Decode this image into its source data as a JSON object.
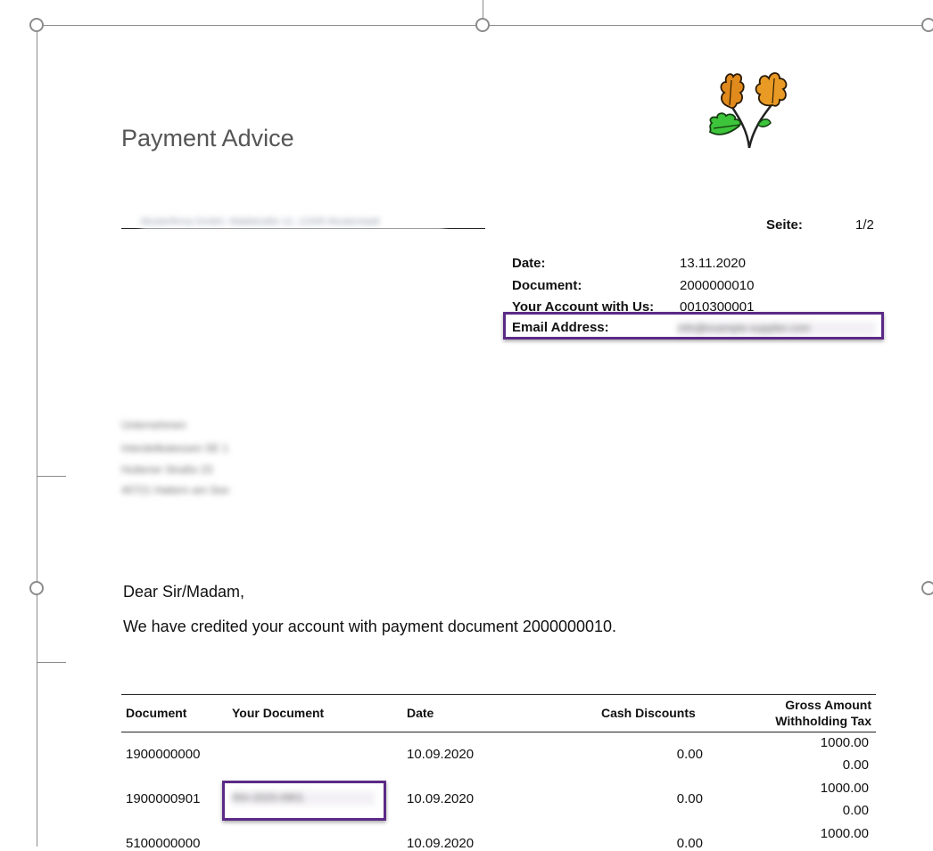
{
  "document": {
    "title": "Payment Advice",
    "sender_line": "Musterfirma GmbH, Waldstraße 12, 12345 Musterstadt",
    "page_label": "Seite:",
    "page_value": "1/2"
  },
  "meta": {
    "date_label": "Date:",
    "date_value": "13.11.2020",
    "document_label": "Document:",
    "document_value": "2000000010",
    "account_label": "Your Account with Us:",
    "account_value": "0010300001",
    "email_label": "Email Address:",
    "email_value": "info@example-supplier.com"
  },
  "recipient": {
    "lines": [
      "Unternehmen",
      "Interdelikatessen SE 1",
      "Huttener Straße 23",
      "40721 Hattern am See"
    ]
  },
  "letter": {
    "greeting": "Dear Sir/Madam,",
    "body": "We have credited your account with payment document 2000000010."
  },
  "table": {
    "headers": {
      "document": "Document",
      "your_document": "Your Document",
      "date": "Date",
      "cash_discounts": "Cash Discounts",
      "gross_amount": "Gross Amount",
      "withholding_tax": "Withholding Tax"
    },
    "rows": [
      {
        "document": "1900000000",
        "your_document": "",
        "date": "10.09.2020",
        "cash_discounts": "0.00",
        "gross_amount": "1000.00",
        "withholding_tax": "0.00"
      },
      {
        "document": "1900000901",
        "your_document": "INV-2020-0901",
        "date": "10.09.2020",
        "cash_discounts": "0.00",
        "gross_amount": "1000.00",
        "withholding_tax": "0.00"
      },
      {
        "document": "5100000000",
        "your_document": "",
        "date": "10.09.2020",
        "cash_discounts": "0.00",
        "gross_amount": "1000.00",
        "withholding_tax": ""
      }
    ]
  },
  "colors": {
    "highlight_border": "#5b2a86",
    "frame": "#8c8c8c",
    "title": "#555555"
  },
  "icons": {
    "logo": "oak-leaves-logo"
  }
}
